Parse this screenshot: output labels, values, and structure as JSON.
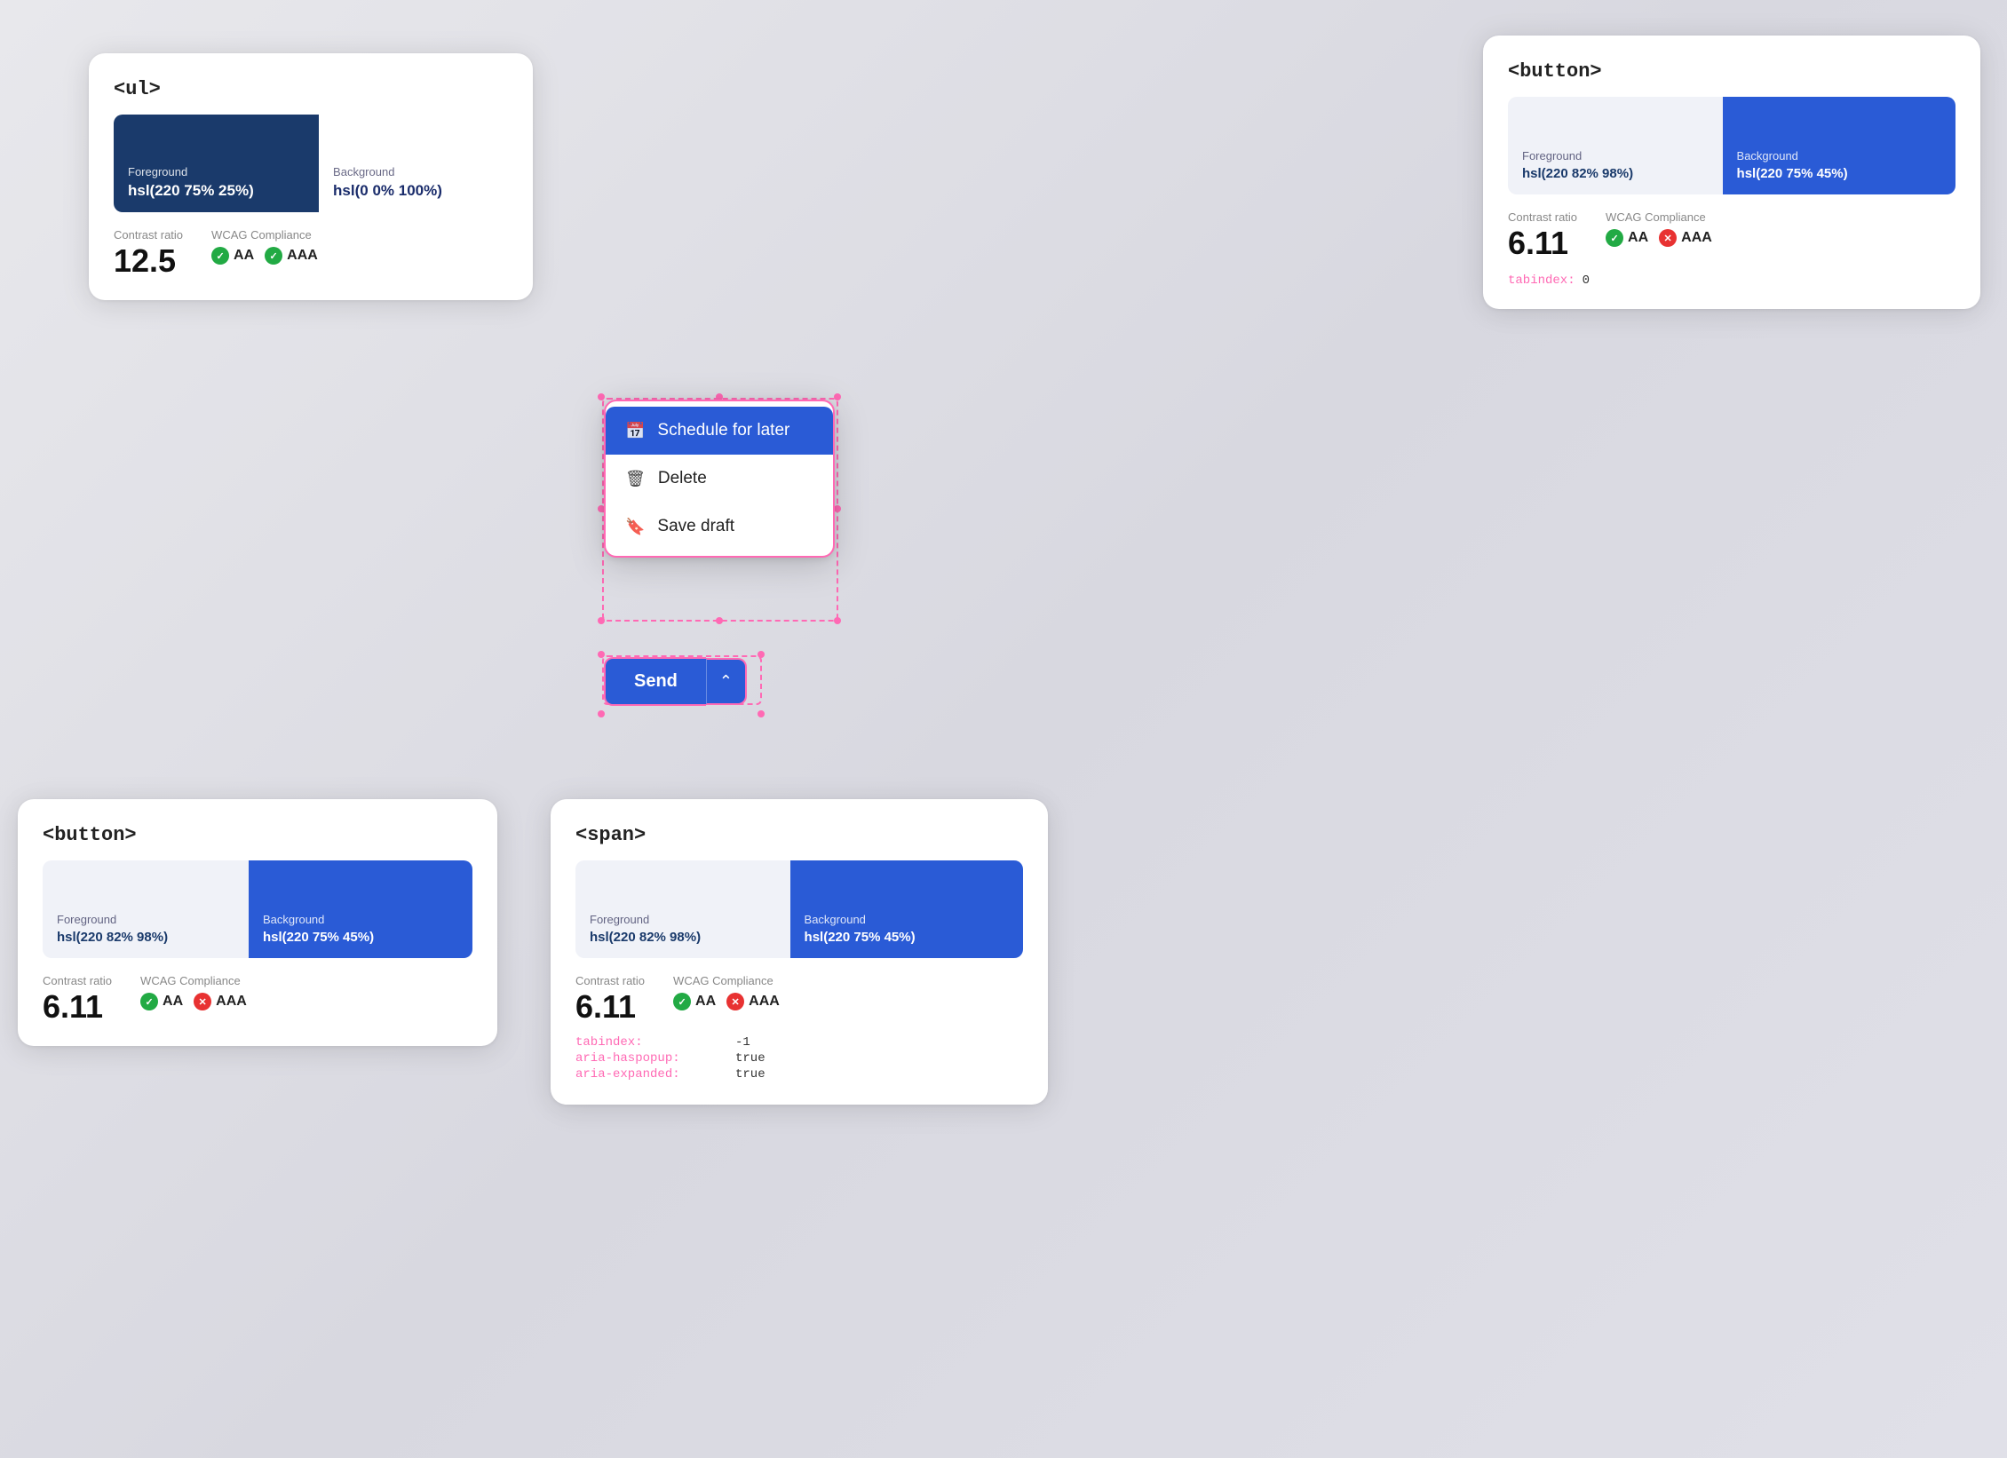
{
  "cards": {
    "ul_card": {
      "title": "<ul>",
      "fg_label": "Foreground",
      "fg_value": "hsl(220 75% 25%)",
      "bg_label": "Background",
      "bg_value": "hsl(0 0% 100%)",
      "contrast_label": "Contrast ratio",
      "contrast_value": "12.5",
      "wcag_label": "WCAG Compliance",
      "aa_label": "AA",
      "aaa_label": "AAA",
      "aa_pass": true,
      "aaa_pass": true
    },
    "button_top": {
      "title": "<button>",
      "fg_label": "Foreground",
      "fg_value": "hsl(220 82% 98%)",
      "bg_label": "Background",
      "bg_value": "hsl(220 75% 45%)",
      "contrast_label": "Contrast ratio",
      "contrast_value": "6.11",
      "wcag_label": "WCAG Compliance",
      "aa_label": "AA",
      "aaa_label": "AAA",
      "aa_pass": true,
      "aaa_pass": false,
      "tabindex_label": "tabindex:",
      "tabindex_value": "0"
    },
    "button_bottom": {
      "title": "<button>",
      "fg_label": "Foreground",
      "fg_value": "hsl(220 82% 98%)",
      "bg_label": "Background",
      "bg_value": "hsl(220 75% 45%)",
      "contrast_label": "Contrast ratio",
      "contrast_value": "6.11",
      "wcag_label": "WCAG Compliance",
      "aa_label": "AA",
      "aaa_label": "AAA",
      "aa_pass": true,
      "aaa_pass": false
    },
    "span_card": {
      "title": "<span>",
      "fg_label": "Foreground",
      "fg_value": "hsl(220 82% 98%)",
      "bg_label": "Background",
      "bg_value": "hsl(220 75% 45%)",
      "contrast_label": "Contrast ratio",
      "contrast_value": "6.11",
      "wcag_label": "WCAG Compliance",
      "aa_label": "AA",
      "aaa_label": "AAA",
      "aa_pass": true,
      "aaa_pass": false,
      "tabindex_label": "tabindex:",
      "tabindex_value": "-1",
      "aria_haspopup_label": "aria-haspopup:",
      "aria_haspopup_value": "true",
      "aria_expanded_label": "aria-expanded:",
      "aria_expanded_value": "true"
    }
  },
  "dropdown": {
    "item1_label": "Schedule for later",
    "item2_label": "Delete",
    "item3_label": "Save draft"
  },
  "send_button": {
    "label": "Send",
    "chevron": "^"
  },
  "icons": {
    "calendar": "📅",
    "trash": "🗑",
    "bookmark": "🔖",
    "check": "✓",
    "x": "✕"
  }
}
